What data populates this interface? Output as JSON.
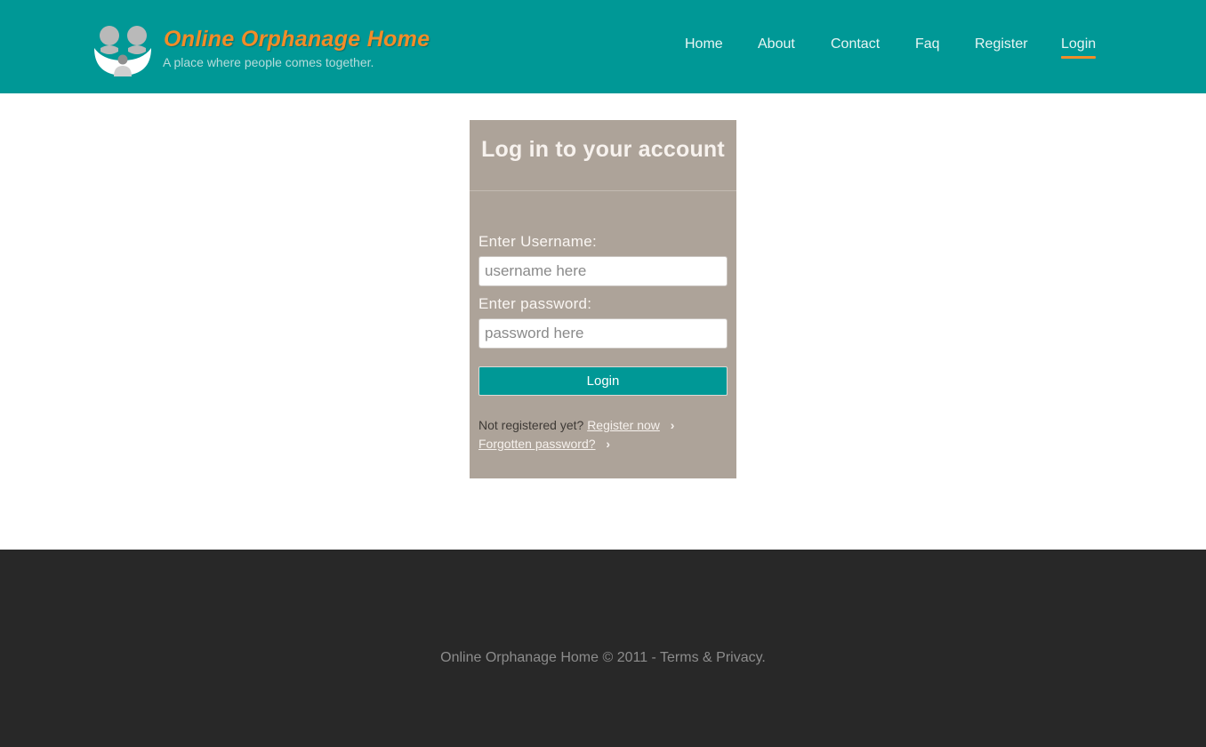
{
  "brand": {
    "title": "Online Orphanage Home",
    "tagline": "A place where people comes together.",
    "logo_icon": "family-icon",
    "colors": {
      "header": "#009896",
      "accent": "#f28c28"
    }
  },
  "nav": {
    "items": [
      {
        "label": "Home"
      },
      {
        "label": "About"
      },
      {
        "label": "Contact"
      },
      {
        "label": "Faq"
      },
      {
        "label": "Register"
      },
      {
        "label": "Login",
        "active": true
      }
    ]
  },
  "login": {
    "title": "Log in to your account",
    "username_label": "Enter Username:",
    "username_placeholder": "username here",
    "username_value": "",
    "password_label": "Enter password:",
    "password_placeholder": "password here",
    "password_value": "",
    "submit_label": "Login",
    "not_registered_text": "Not registered yet?",
    "register_link": "Register now",
    "forgot_link": "Forgotten password?",
    "chevron": "›",
    "colors": {
      "panel": "#ada399",
      "button": "#009896"
    }
  },
  "footer": {
    "text": "Online Orphanage Home © 2011 - Terms & Privacy."
  }
}
